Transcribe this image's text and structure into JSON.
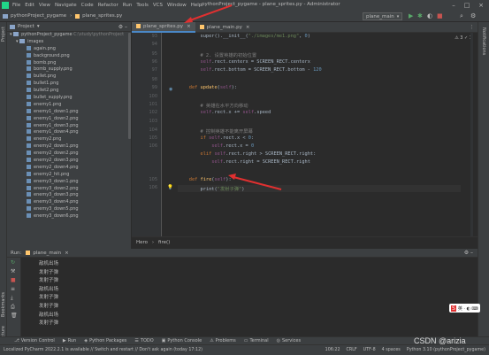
{
  "app": {
    "window_title": "pythonProject_pygame - plane_sprites.py - Administrator",
    "menu": [
      "File",
      "Edit",
      "View",
      "Navigate",
      "Code",
      "Refactor",
      "Run",
      "Tools",
      "VCS",
      "Window",
      "Help"
    ]
  },
  "navbar": {
    "breadcrumb": [
      "pythonProject_pygame",
      "plane_sprites.py"
    ],
    "run_config": "plane_main"
  },
  "project": {
    "header": "Project",
    "root": "pythonProject_pygame",
    "root_path": "C:\\study\\pythonProject",
    "folder": "images",
    "files": [
      "again.png",
      "background.png",
      "bomb.png",
      "bomb_supply.png",
      "bullet.png",
      "bullet1.png",
      "bullet2.png",
      "bullet_supply.png",
      "enemy1.png",
      "enemy1_down1.png",
      "enemy1_down2.png",
      "enemy1_down3.png",
      "enemy1_down4.png",
      "enemy2.png",
      "enemy2_down1.png",
      "enemy2_down2.png",
      "enemy2_down3.png",
      "enemy2_down4.png",
      "enemy2_hit.png",
      "enemy3_down1.png",
      "enemy3_down2.png",
      "enemy3_down3.png",
      "enemy3_down4.png",
      "enemy3_down5.png",
      "enemy3_down6.png"
    ]
  },
  "editor": {
    "tabs": [
      {
        "label": "plane_sprites.py"
      },
      {
        "label": "plane_main.py"
      }
    ],
    "line_numbers": [
      "",
      "",
      "",
      "",
      "",
      "",
      "",
      "",
      "",
      "",
      "",
      "",
      "",
      "",
      "",
      "",
      "",
      "",
      "",
      "",
      "",
      "",
      "",
      "",
      "",
      "",
      "",
      "",
      "105",
      "106"
    ],
    "visible_line_numbers": [
      {
        "n": "93",
        "k": 0
      },
      {
        "n": "94",
        "k": 1
      },
      {
        "n": "95",
        "k": 2
      },
      {
        "n": "96",
        "k": 3
      },
      {
        "n": "97",
        "k": 4
      },
      {
        "n": "98",
        "k": 5
      },
      {
        "n": "99",
        "k": 6
      },
      {
        "n": "100",
        "k": 7
      },
      {
        "n": "101",
        "k": 8
      },
      {
        "n": "102",
        "k": 9
      },
      {
        "n": "103",
        "k": 10
      },
      {
        "n": "104",
        "k": 11
      },
      {
        "n": "105",
        "k": 12
      },
      {
        "n": "106",
        "k": 13
      }
    ],
    "breadcrumb": [
      "Hero",
      "fire()"
    ],
    "inspection": "⚠ 3 ✓ 1"
  },
  "run": {
    "tab_label": "Run:",
    "config": "plane_main",
    "output": [
      "敌机出场",
      "发射子弹",
      "发射子弹",
      "敌机出场",
      "发射子弹",
      "发射子弹",
      "敌机出场",
      "发射子弹"
    ]
  },
  "bottom_tools": [
    "Version Control",
    "Run",
    "Python Packages",
    "TODO",
    "Python Console",
    "Problems",
    "Terminal",
    "Services"
  ],
  "status": {
    "message": "Localized PyCharm 2022.2.1 is available // Switch and restart // Don't ask again (today 17:12)",
    "position": "106:22",
    "line_sep": "CRLF",
    "encoding": "UTF-8",
    "indent": "4 spaces",
    "interpreter": "Python 3.10 (pythonProject_pygame)"
  },
  "watermark": "CSDN @arizia",
  "colors": {
    "accent": "#4a88c7",
    "annotation_red": "#e03030"
  }
}
